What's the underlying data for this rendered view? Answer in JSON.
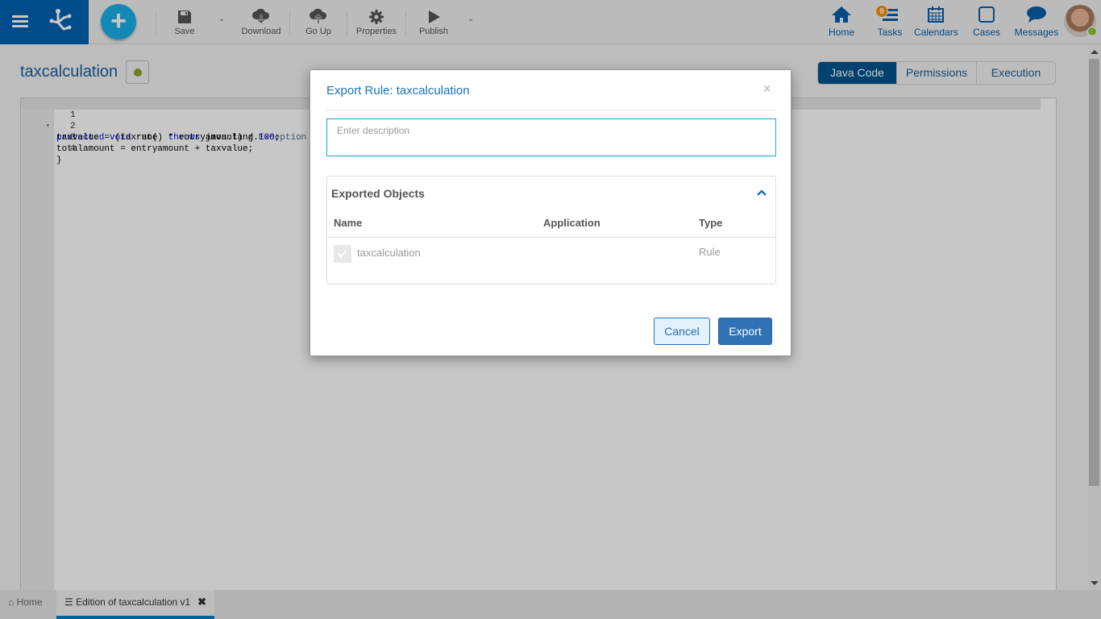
{
  "toolbar": {
    "new_label": "+",
    "save": "Save",
    "download": "Download",
    "go_up": "Go Up",
    "properties": "Properties",
    "publish": "Publish"
  },
  "nav": {
    "home": "Home",
    "tasks": "Tasks",
    "tasks_badge": "9",
    "calendars": "Calendars",
    "cases": "Cases",
    "messages": "Messages"
  },
  "page": {
    "title": "taxcalculation",
    "tabs": [
      {
        "label": "Java Code",
        "active": true
      },
      {
        "label": "Permissions",
        "active": false
      },
      {
        "label": "Execution",
        "active": false
      }
    ]
  },
  "editor": {
    "lines": [
      {
        "n": "1",
        "text": "protected void run() throws java.lang.Exception {"
      },
      {
        "n": "2",
        "text": "taxvalue = (taxrate  * entryamount) / 100;"
      },
      {
        "n": "3",
        "text": "totalamount = entryamount + taxvalue;"
      },
      {
        "n": "4",
        "text": "}"
      }
    ]
  },
  "bottom_tabs": {
    "home": "Home",
    "active": "Edition of taxcalculation v1"
  },
  "modal": {
    "title": "Export Rule: taxcalculation",
    "description_placeholder": "Enter description",
    "description_value": "",
    "panel_title": "Exported Objects",
    "columns": {
      "name": "Name",
      "application": "Application",
      "type": "Type"
    },
    "rows": [
      {
        "name": "taxcalculation",
        "application": "",
        "type": "Rule",
        "checked": true
      }
    ],
    "cancel": "Cancel",
    "export": "Export"
  },
  "colors": {
    "brand": "#0061b0",
    "accent": "#1ab0ea",
    "badge": "#f39200",
    "online": "#8dc63f"
  }
}
